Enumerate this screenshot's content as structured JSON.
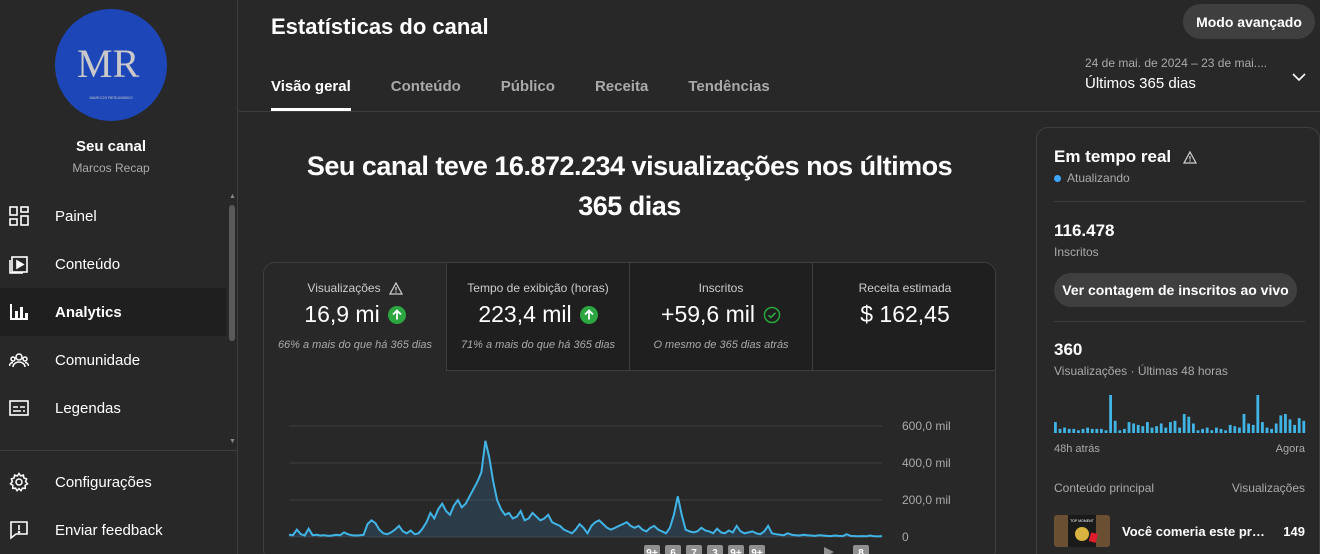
{
  "sidebar": {
    "avatar_initials": "MR",
    "avatar_tagline": "MARCOS RESUMINDO",
    "channel_label": "Seu canal",
    "channel_name": "Marcos Recap",
    "items": [
      {
        "label": "Painel",
        "icon": "dashboard-icon"
      },
      {
        "label": "Conteúdo",
        "icon": "content-icon"
      },
      {
        "label": "Analytics",
        "icon": "analytics-icon",
        "active": true
      },
      {
        "label": "Comunidade",
        "icon": "community-icon"
      },
      {
        "label": "Legendas",
        "icon": "subtitles-icon"
      }
    ],
    "footer_items": [
      {
        "label": "Configurações",
        "icon": "gear-icon"
      },
      {
        "label": "Enviar feedback",
        "icon": "feedback-icon"
      }
    ]
  },
  "header": {
    "title": "Estatísticas do canal",
    "advanced_button": "Modo avançado",
    "tabs": [
      "Visão geral",
      "Conteúdo",
      "Público",
      "Receita",
      "Tendências"
    ],
    "date_range": "24 de mai. de 2024 – 23 de mai....",
    "date_label": "Últimos 365 dias"
  },
  "main": {
    "headline_line1": "Seu canal teve 16.872.234 visualizações nos últimos",
    "headline_line2": "365 dias",
    "metrics": [
      {
        "label": "Visualizações",
        "value": "16,9 mi",
        "note": "66% a mais do que há 365 dias",
        "status": "up"
      },
      {
        "label": "Tempo de exibição (horas)",
        "value": "223,4 mil",
        "note": "71% a mais do que há 365 dias",
        "status": "up"
      },
      {
        "label": "Inscritos",
        "value": "+59,6 mil",
        "note": "O mesmo de 365 dias atrás",
        "status": "same"
      },
      {
        "label": "Receita estimada",
        "value": "$ 162,45",
        "note": "",
        "status": "none"
      }
    ]
  },
  "chart_data": {
    "type": "area",
    "title": "",
    "xlabel": "",
    "ylabel": "",
    "ylim": [
      0,
      600000
    ],
    "y_ticks": [
      "0",
      "200,0 mil",
      "400,0 mil",
      "600,0 mil"
    ],
    "values": [
      12000,
      10000,
      40000,
      15000,
      8000,
      45000,
      10000,
      12000,
      8000,
      10000,
      6000,
      8000,
      12000,
      10000,
      25000,
      15000,
      10000,
      8000,
      10000,
      12000,
      70000,
      90000,
      75000,
      40000,
      20000,
      15000,
      25000,
      40000,
      60000,
      30000,
      20000,
      35000,
      15000,
      20000,
      45000,
      80000,
      130000,
      100000,
      150000,
      180000,
      140000,
      120000,
      170000,
      200000,
      160000,
      180000,
      220000,
      260000,
      300000,
      350000,
      520000,
      430000,
      300000,
      200000,
      150000,
      120000,
      130000,
      100000,
      110000,
      140000,
      90000,
      100000,
      130000,
      110000,
      90000,
      100000,
      120000,
      80000,
      70000,
      60000,
      40000,
      30000,
      20000,
      40000,
      70000,
      50000,
      20000,
      60000,
      80000,
      90000,
      70000,
      50000,
      40000,
      50000,
      60000,
      70000,
      80000,
      60000,
      50000,
      60000,
      40000,
      30000,
      50000,
      60000,
      40000,
      30000,
      20000,
      50000,
      120000,
      220000,
      120000,
      40000,
      30000,
      25000,
      30000,
      50000,
      35000,
      30000,
      20000,
      45000,
      25000,
      20000,
      35000,
      25000,
      60000,
      30000,
      20000,
      25000,
      30000,
      20000,
      15000,
      30000,
      60000,
      20000,
      15000,
      12000,
      10000,
      20000,
      12000,
      10000,
      8000,
      12000,
      10000,
      8000,
      6000,
      10000,
      8000,
      6000,
      5000,
      8000,
      6000,
      5000,
      15000,
      6000,
      5000,
      4000,
      5000,
      4000,
      8000,
      4000,
      3000,
      5000
    ]
  },
  "pager_labels": [
    "9+",
    "6",
    "7",
    "3",
    "9+",
    "9+",
    "8"
  ],
  "realtime": {
    "title": "Em tempo real",
    "status": "Atualizando",
    "subscribers_value": "116.478",
    "subscribers_label": "Inscritos",
    "live_button": "Ver contagem de inscritos ao vivo",
    "views_value": "360",
    "views_label": "Visualizações · Últimas 48 horas",
    "axis_start": "48h atrás",
    "axis_end": "Agora",
    "col_content": "Conteúdo principal",
    "col_views": "Visualizações",
    "bars": [
      8,
      3,
      4,
      3,
      3,
      2,
      3,
      4,
      3,
      3,
      3,
      2,
      28,
      9,
      2,
      3,
      8,
      7,
      6,
      5,
      8,
      4,
      5,
      7,
      4,
      8,
      9,
      4,
      14,
      12,
      7,
      2,
      3,
      4,
      2,
      4,
      3,
      2,
      6,
      5,
      4,
      14,
      7,
      6,
      28,
      8,
      4,
      3,
      7,
      13,
      14,
      10,
      6,
      11,
      9
    ],
    "top_video": "Você comeria este prato?",
    "top_video_views": "149",
    "thumb_badge": "TOP MOMENT"
  }
}
